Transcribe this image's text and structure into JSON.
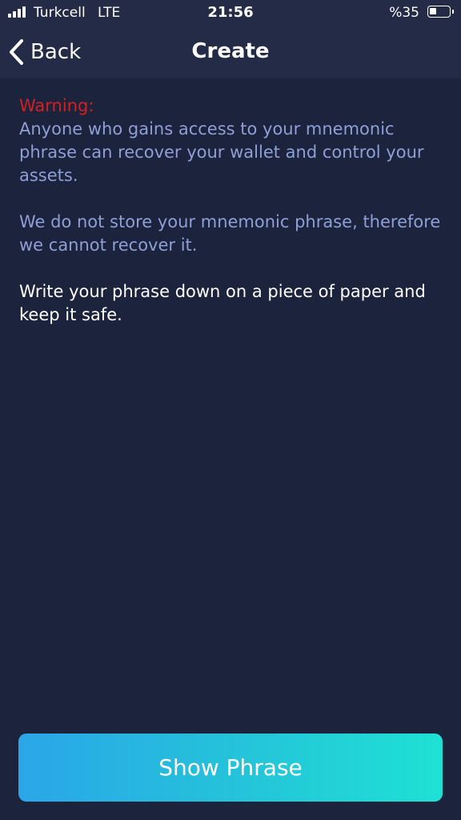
{
  "status_bar": {
    "carrier": "Turkcell",
    "network": "LTE",
    "time": "21:56",
    "battery_percent": "%35",
    "battery_level": 0.35
  },
  "nav": {
    "back_label": "Back",
    "title": "Create"
  },
  "content": {
    "warning_label": "Warning:",
    "warning_p1": "Anyone who gains access to your mnemonic phrase can recover your wallet and control your assets.",
    "warning_p2": "We do not store your mnemonic phrase, therefore we cannot recover it.",
    "advice": "Write your phrase down on a piece of paper and keep it safe."
  },
  "actions": {
    "show_phrase_label": "Show Phrase"
  },
  "colors": {
    "background": "#1c233d",
    "header": "#232b47",
    "warning": "#d61f1f",
    "muted_text": "#8f9fd6",
    "button_gradient_start": "#2aa6e8",
    "button_gradient_end": "#1ee1d4"
  }
}
